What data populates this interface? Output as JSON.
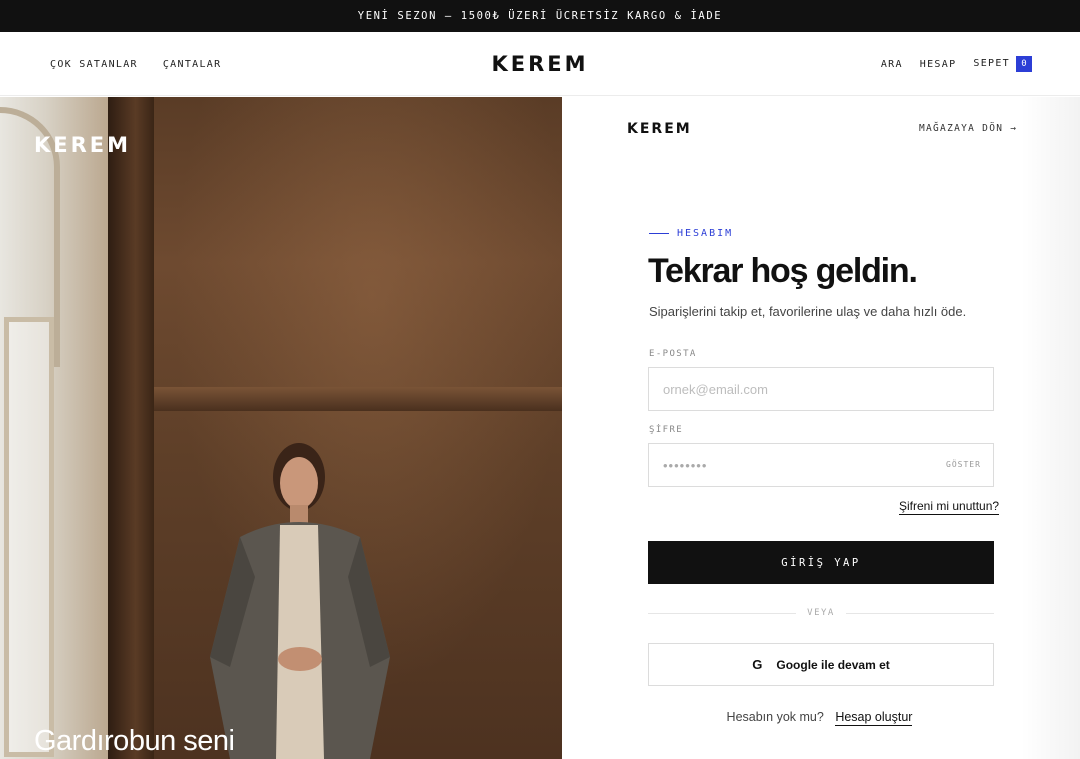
{
  "announcement": "YENİ SEZON — 1500₺ ÜZERİ ÜCRETSİZ KARGO & İADE",
  "header": {
    "logo": "KEREM",
    "nav_left": [
      "ÇOK SATANLAR",
      "ÇANTALAR"
    ],
    "nav_right": {
      "search": "ARA",
      "account": "HESAP",
      "cart": "SEPET",
      "cart_count": "0"
    }
  },
  "hero": {
    "brand": "KEREM",
    "caption": "Gardırobun seni"
  },
  "login": {
    "brand": "KEREM",
    "back_link": "MAĞAZAYA DÖN →",
    "eyebrow": "HESABIM",
    "heading": "Tekrar hoş geldin.",
    "subtext": "Siparişlerini takip et, favorilerine ulaş ve daha hızlı öde.",
    "email_label": "E-POSTA",
    "email_placeholder": "ornek@email.com",
    "password_label": "ŞİFRE",
    "password_placeholder": "••••••••",
    "show_label": "GÖSTER",
    "forgot": "Şifreni mi unuttun?",
    "submit": "GİRİŞ YAP",
    "or": "VEYA",
    "google_icon": "G",
    "google": "Google ile devam et",
    "signup_prompt": "Hesabın yok mu?",
    "signup_link": "Hesap oluştur"
  },
  "colors": {
    "accent": "#2c3ed6",
    "dark": "#111111"
  }
}
